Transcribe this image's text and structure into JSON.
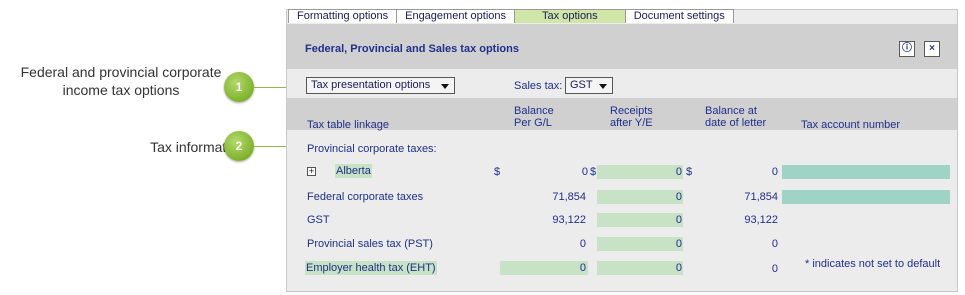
{
  "callouts": [
    {
      "number": "1",
      "text_line1": "Federal and provincial corporate",
      "text_line2": "income tax options"
    },
    {
      "number": "2",
      "text": "Tax information"
    }
  ],
  "tabs": [
    {
      "label": "Formatting options",
      "active": false
    },
    {
      "label": "Engagement options",
      "active": false
    },
    {
      "label": "Tax options",
      "active": true
    },
    {
      "label": "Document settings",
      "active": false
    }
  ],
  "panel": {
    "title": "Federal, Provincial and Sales tax options",
    "info_glyph": "ⓘ",
    "close_glyph": "×"
  },
  "controls": {
    "tax_presentation": "Tax presentation options",
    "sales_tax_label": "Sales tax:",
    "sales_tax_value": "GST"
  },
  "columns": {
    "linkage": "Tax table linkage",
    "balance_gl_1": "Balance",
    "balance_gl_2": "Per G/L",
    "receipts_1": "Receipts",
    "receipts_2": "after Y/E",
    "balance_letter_1": "Balance at",
    "balance_letter_2": "date of letter",
    "account": "Tax account number"
  },
  "rows": {
    "provincial_heading": "Provincial corporate taxes:",
    "alberta": {
      "expander": "+",
      "name": "Alberta",
      "currency1": "$",
      "balance": "0",
      "currency2": "$",
      "receipts": "0",
      "currency3": "$",
      "letter": "0"
    },
    "federal": {
      "name": "Federal corporate taxes",
      "balance": "71,854",
      "receipts": "0",
      "letter": "71,854"
    },
    "gst": {
      "name": "GST",
      "balance": "93,122",
      "receipts": "0",
      "letter": "93,122"
    },
    "pst": {
      "name": "Provincial sales tax (PST)",
      "balance": "0",
      "receipts": "0",
      "letter": "0"
    },
    "eht": {
      "name": "Employer health tax (EHT)",
      "balance": "0",
      "receipts": "0",
      "letter": "0"
    }
  },
  "footnote": "* indicates not set to default",
  "colors": {
    "accent_green": "#7fb32c",
    "field_green": "#c7e2c5",
    "field_teal": "#9fd3c6",
    "text_blue": "#1f2f8a"
  }
}
